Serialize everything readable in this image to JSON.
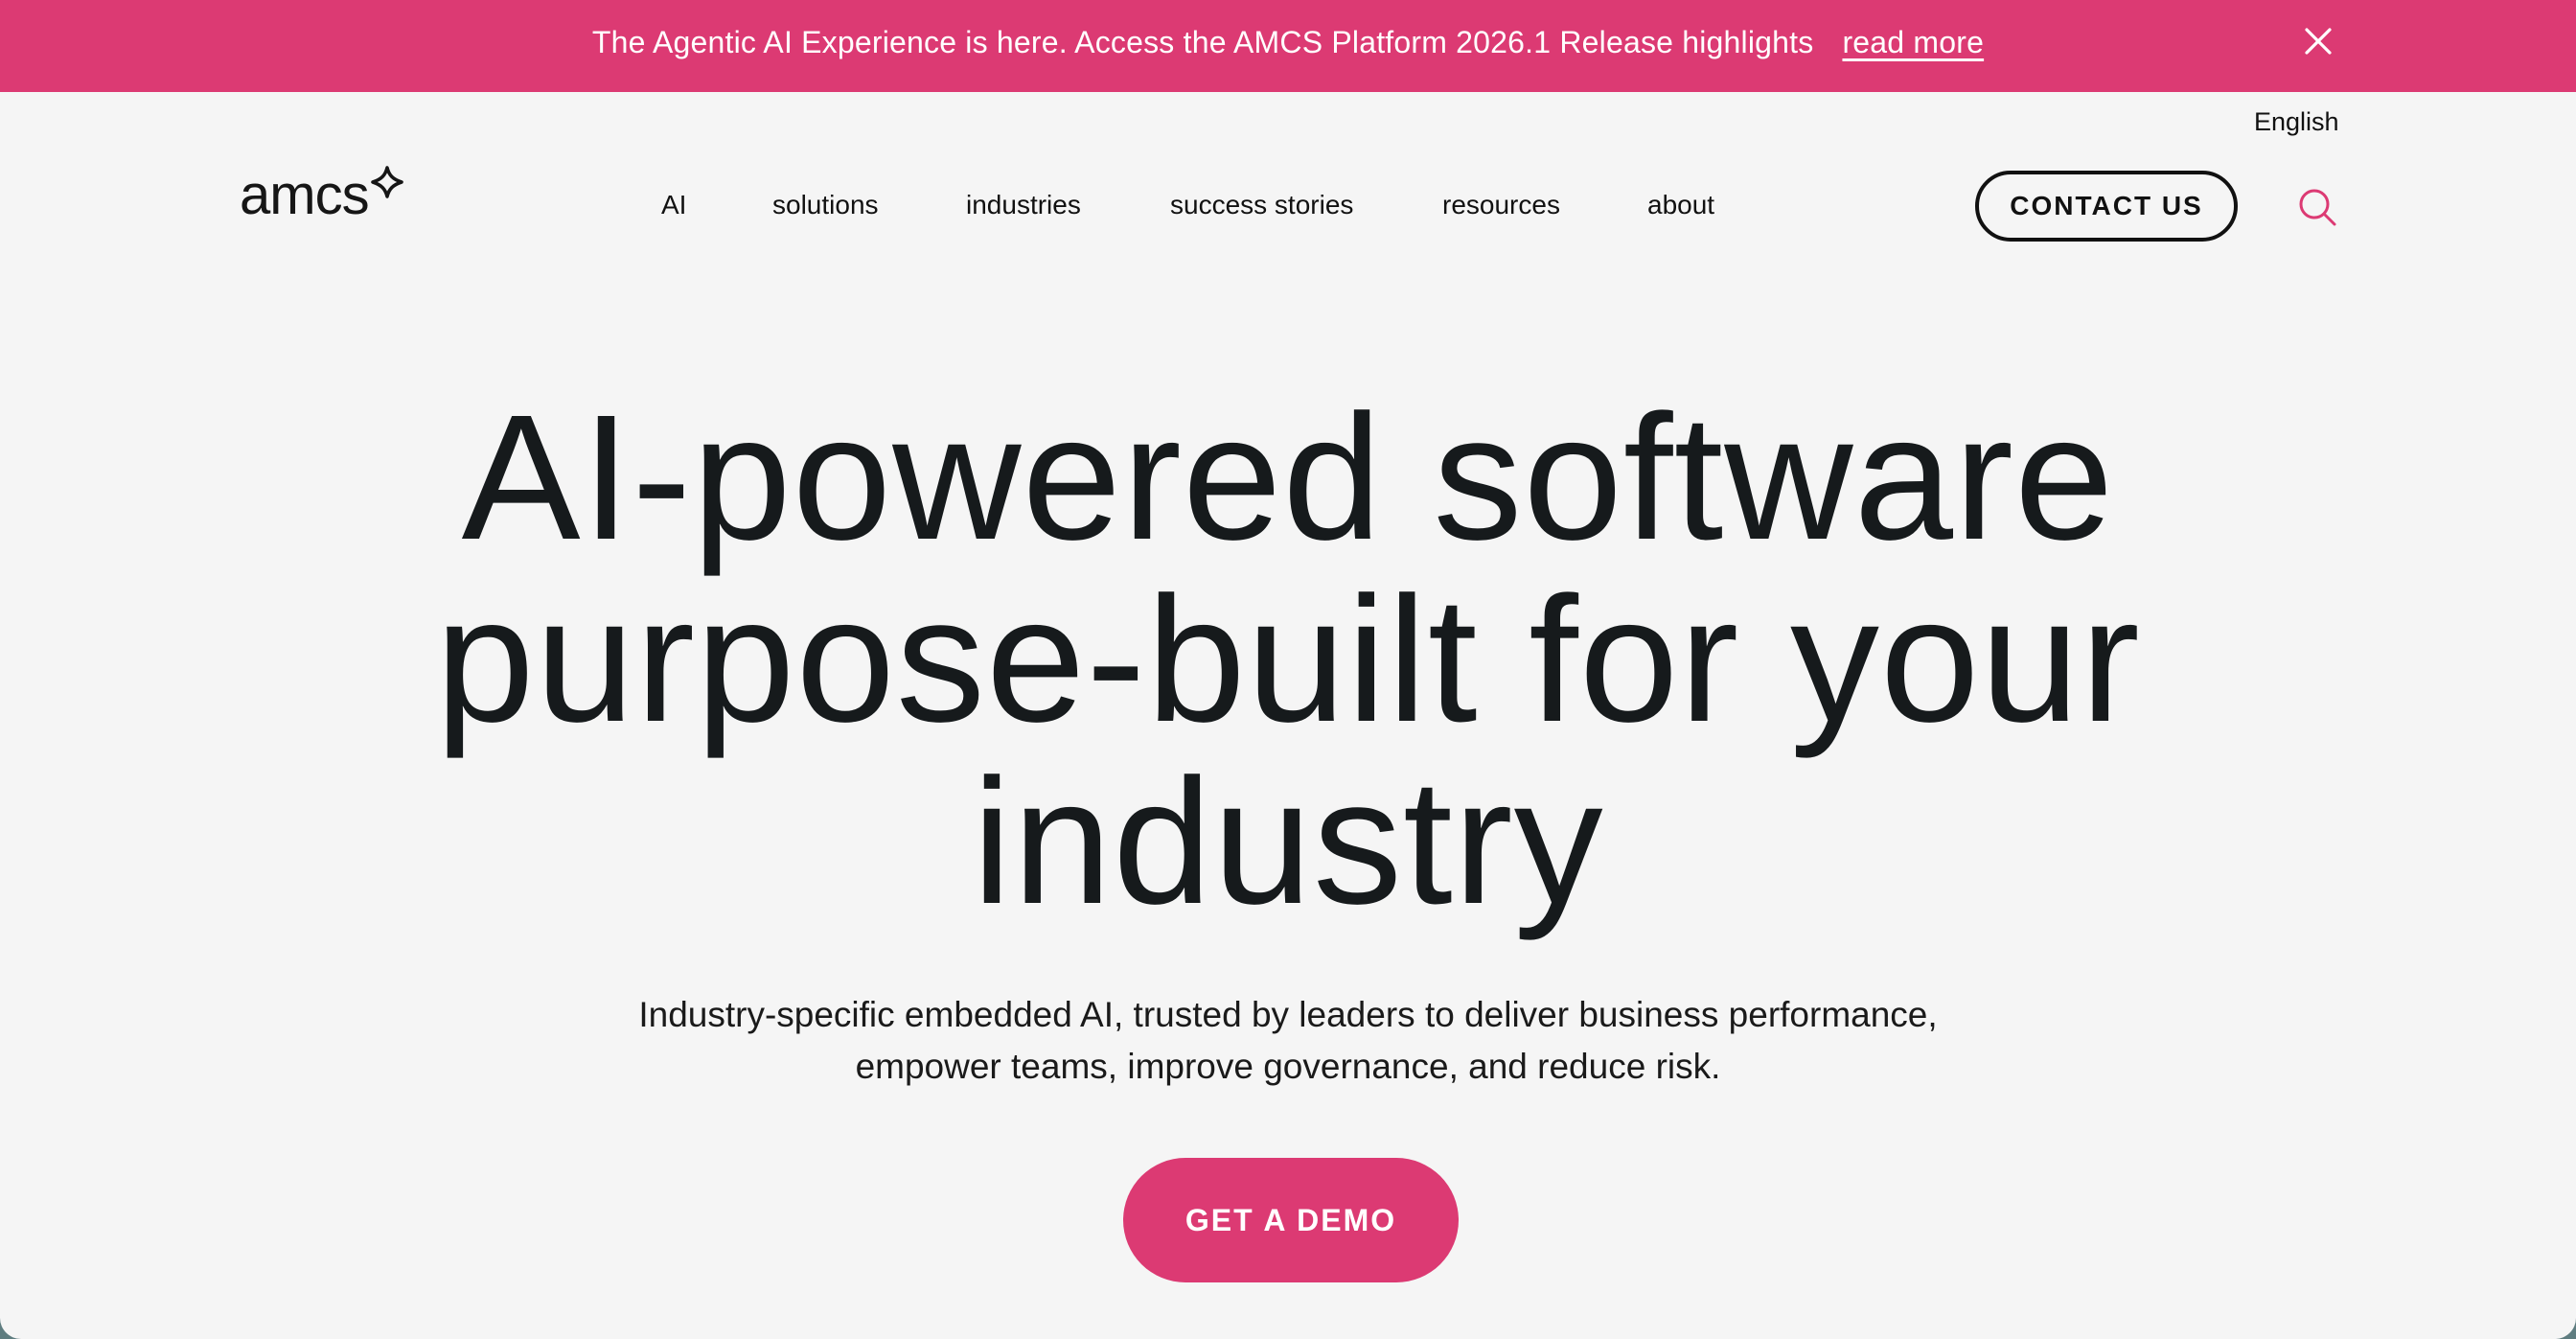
{
  "banner": {
    "message": "The Agentic AI Experience is here. Access the AMCS Platform 2026.1 Release highlights",
    "link_label": "read more",
    "close_icon": "close-icon",
    "background": "#dc3a73"
  },
  "utility": {
    "language": "English"
  },
  "header": {
    "logo_text": "amcs",
    "logo_icon": "spark-icon",
    "nav": [
      {
        "label": "AI"
      },
      {
        "label": "solutions"
      },
      {
        "label": "industries"
      },
      {
        "label": "success stories"
      },
      {
        "label": "resources"
      },
      {
        "label": "about"
      }
    ],
    "contact_label": "CONTACT US",
    "search_icon": "search-icon",
    "accent": "#dc3a73"
  },
  "hero": {
    "title_line1": "AI-powered software",
    "title_line2": "purpose-built for your",
    "title_line3": "industry",
    "subtitle_line1": "Industry-specific embedded AI, trusted by leaders to deliver business performance,",
    "subtitle_line2": "empower teams, improve governance, and reduce risk.",
    "cta_label": "GET A DEMO"
  }
}
